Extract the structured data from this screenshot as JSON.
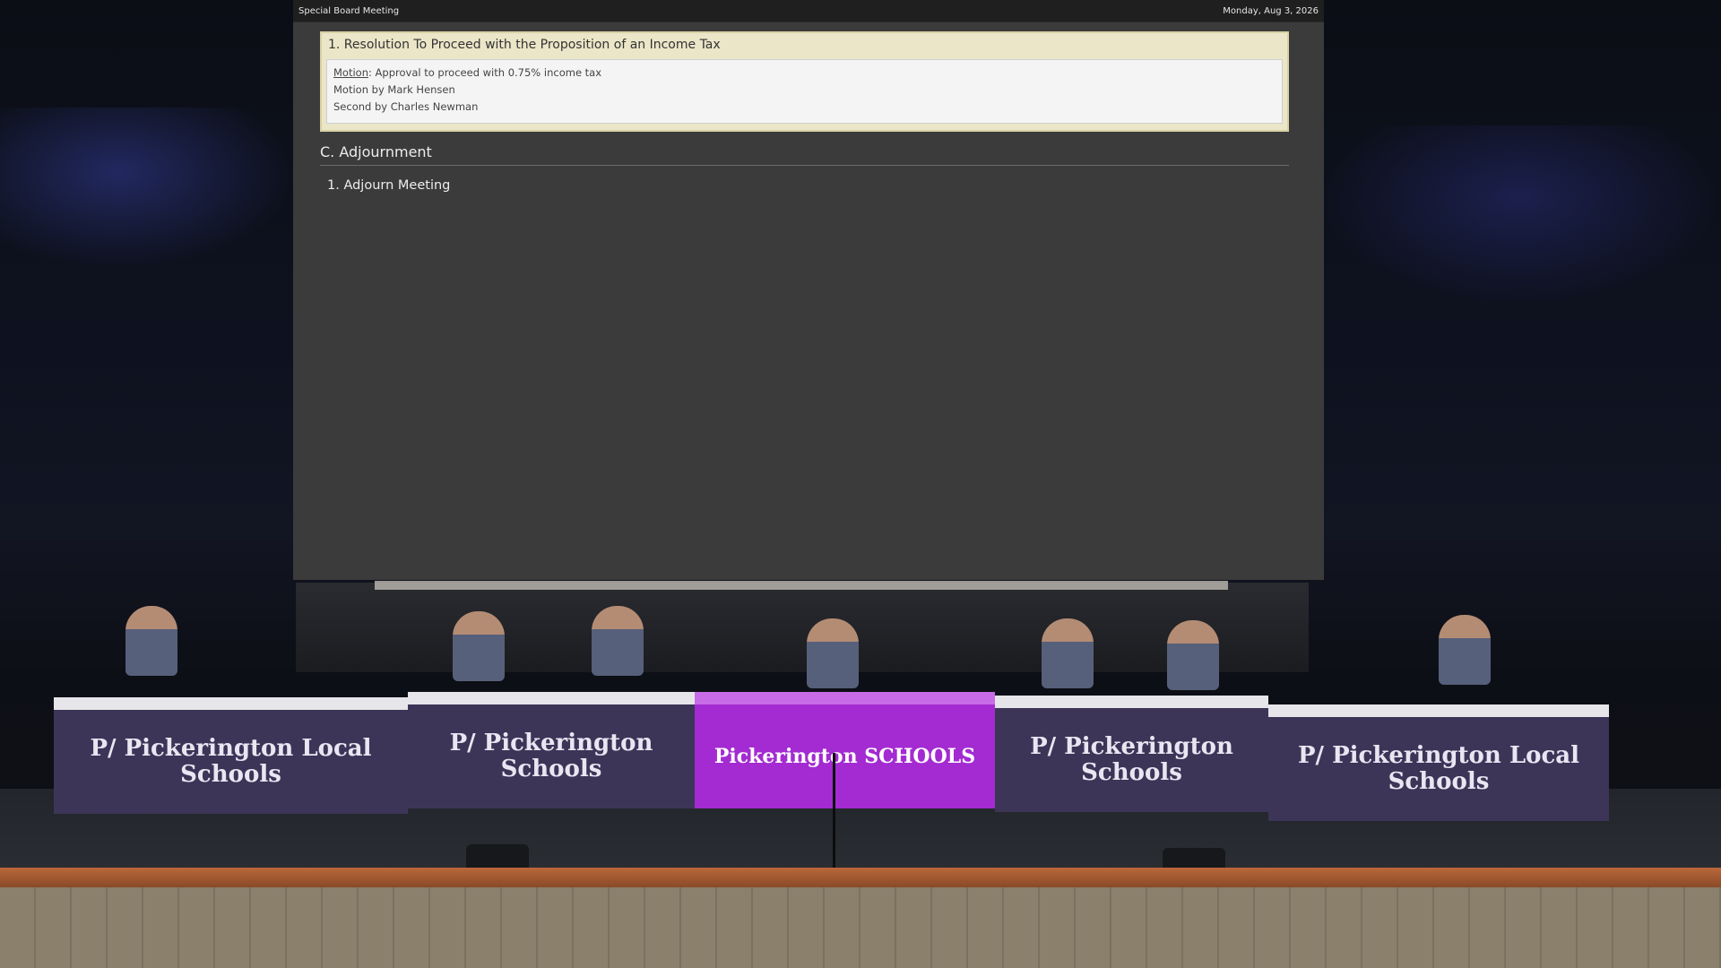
{
  "header": {
    "meeting_title": "Special Board Meeting",
    "meeting_date": "Monday, Aug 3, 2026"
  },
  "agenda": {
    "current_item": {
      "title": "1. Resolution To Proceed with the Proposition of an Income Tax",
      "motion_label": "Motion",
      "motion_text": ": Approval to proceed with 0.75% income tax",
      "motion_by": "Motion by Mark Hensen",
      "second_by": "Second by Charles Newman"
    },
    "section": {
      "heading": "C. Adjournment",
      "items": [
        {
          "label": "1. Adjourn Meeting"
        }
      ]
    }
  },
  "stage": {
    "table_banners": [
      "P/ Pickerington Local Schools",
      "P/ Pickerington Schools",
      "Pickerington SCHOOLS",
      "P/ Pickerington Schools",
      "P/ Pickerington Local Schools"
    ]
  },
  "colors": {
    "panel_bg": "#3b3b3b",
    "topbar_bg": "#1f1f1f",
    "item_card_bg": "#ebe6c8",
    "table_purple": "#3d3558",
    "table_center": "#a32bd1"
  }
}
